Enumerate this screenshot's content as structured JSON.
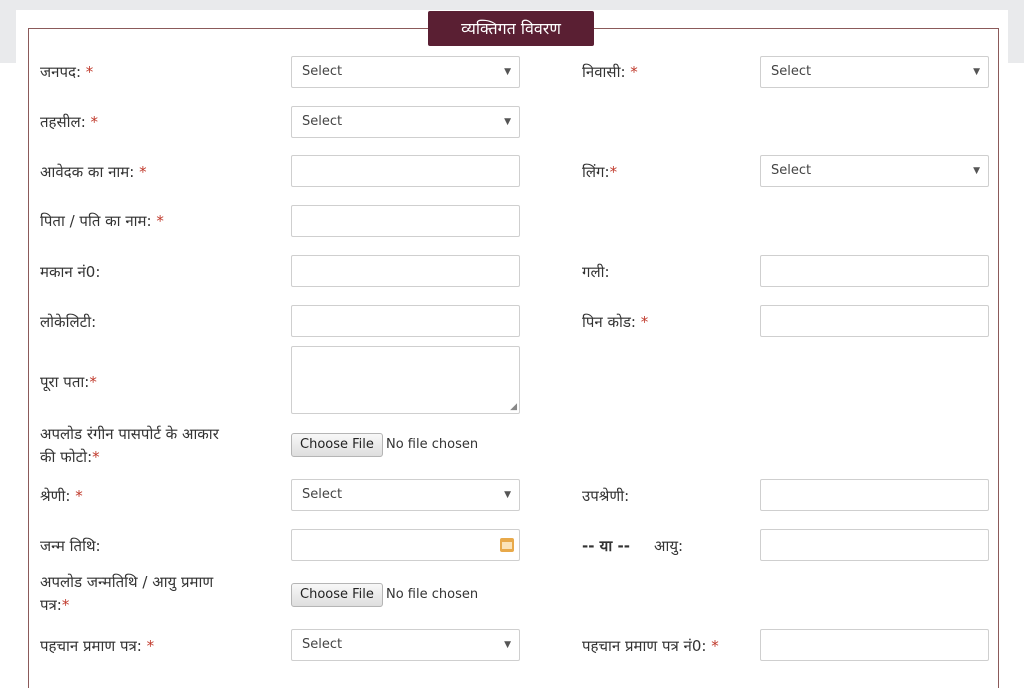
{
  "legend": "व्यक्तिगत विवरण",
  "required_mark": "*",
  "select_text": "Select",
  "file_button": "Choose File",
  "file_status": "No file chosen",
  "labels": {
    "janpad": "जनपद:",
    "niwasi": "निवासी:",
    "tehsil": "तहसील:",
    "aavedak": "आवेदक का नाम:",
    "ling": "लिंग:",
    "pita": "पिता / पति का नाम:",
    "makan": "मकान नं0:",
    "gali": "गली:",
    "locality": "लोकेलिटी:",
    "pincode": "पिन कोड:",
    "pura_pata": "पूरा पता:",
    "photo_line1": "अपलोड रंगीन पासपोर्ट के आकार",
    "photo_line2": "की फोटो:",
    "shreni": "श्रेणी:",
    "upshreni": "उपश्रेणी:",
    "janm_tithi": "जन्म तिथि:",
    "or": "-- या --",
    "aayu": "आयु:",
    "dob_proof_line1": "अपलोड जन्मतिथि / आयु प्रमाण",
    "dob_proof_line2": "पत्र:",
    "id_proof": "पहचान प्रमाण पत्र:",
    "id_proof_no": "पहचान प्रमाण पत्र नं0:"
  },
  "colors": {
    "legend_bg": "#5a1f33",
    "required": "#c0392b",
    "border": "#8b5a5a"
  },
  "icons": [
    "chevron-down-icon",
    "calendar-icon",
    "resize-grip-icon"
  ]
}
